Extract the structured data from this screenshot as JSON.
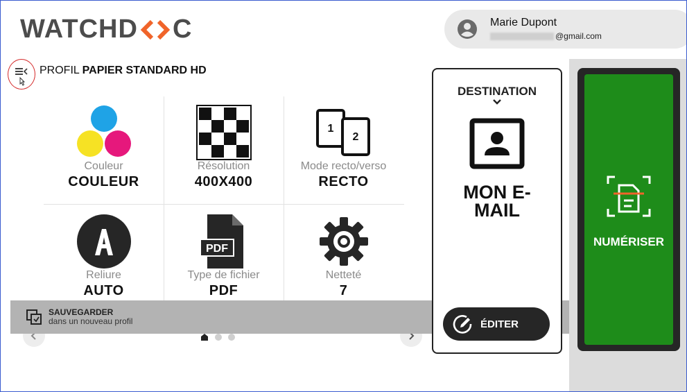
{
  "header": {
    "logo_text_left": "WATCHD",
    "logo_text_right": "C",
    "logo_chevrons": "<>",
    "user_name": "Marie Dupont",
    "user_email_domain": "@gmail.com"
  },
  "profile": {
    "prefix": "PROFIL",
    "name": "PAPIER STANDARD HD"
  },
  "settings": [
    {
      "label": "Couleur",
      "value": "COULEUR",
      "icon": "color-dots-icon"
    },
    {
      "label": "Résolution",
      "value": "400X400",
      "icon": "checker-icon"
    },
    {
      "label": "Mode recto/verso",
      "value": "RECTO",
      "icon": "duplex-icon"
    },
    {
      "label": "Reliure",
      "value": "AUTO",
      "icon": "letter-a-icon"
    },
    {
      "label": "Type de fichier",
      "value": "PDF",
      "icon": "pdf-file-icon",
      "icon_text": "PDF"
    },
    {
      "label": "Netteté",
      "value": "7",
      "icon": "gear-icon"
    }
  ],
  "duplex_icon_text": [
    "1",
    "2"
  ],
  "pager": {
    "pages": 3,
    "current": 1
  },
  "save": {
    "title": "SAUVEGARDER",
    "subtitle": "dans un nouveau profil"
  },
  "destination": {
    "title": "DESTINATION",
    "value_line1": "MON E-",
    "value_line2": "MAIL",
    "edit_label": "ÉDITER"
  },
  "scan": {
    "label": "NUMÉRISER"
  },
  "colors": {
    "accent_orange": "#f0642a",
    "scan_green": "#1e8c1a",
    "dark": "#262626"
  }
}
